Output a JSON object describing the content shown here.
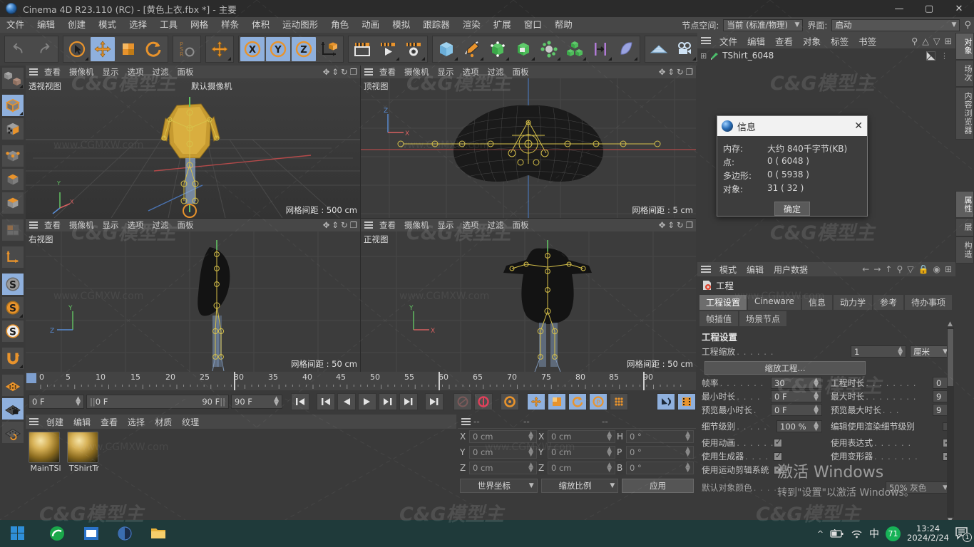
{
  "window": {
    "title": "Cinema 4D R23.110 (RC) - [黄色上衣.fbx *] - 主要",
    "logo_icon": "c4d-logo-icon",
    "minimize": "—",
    "maximize": "▢",
    "close": "✕"
  },
  "menubar": {
    "items": [
      "文件",
      "编辑",
      "创建",
      "模式",
      "选择",
      "工具",
      "网格",
      "样条",
      "体积",
      "运动图形",
      "角色",
      "动画",
      "模拟",
      "跟踪器",
      "渲染",
      "扩展",
      "窗口",
      "帮助"
    ],
    "right": {
      "node_space_label": "节点空间:",
      "node_space_value": "当前 (标准/物理)",
      "layout_label": "界面:",
      "layout_value": "启动",
      "search_icon": "search-icon"
    }
  },
  "viewports": [
    {
      "menu": [
        "查看",
        "摄像机",
        "显示",
        "选项",
        "过滤",
        "面板"
      ],
      "label": "透视视图",
      "camera": "默认摄像机",
      "grid": "网格间距 : 500 cm"
    },
    {
      "menu": [
        "查看",
        "摄像机",
        "显示",
        "选项",
        "过滤",
        "面板"
      ],
      "label": "顶视图",
      "camera": "",
      "grid": "网格间距 : 5 cm"
    },
    {
      "menu": [
        "查看",
        "摄像机",
        "显示",
        "选项",
        "过滤",
        "面板"
      ],
      "label": "右视图",
      "camera": "",
      "grid": "网格间距 : 50 cm"
    },
    {
      "menu": [
        "查看",
        "摄像机",
        "显示",
        "选项",
        "过滤",
        "面板"
      ],
      "label": "正视图",
      "camera": "",
      "grid": "网格间距 : 50 cm"
    }
  ],
  "timeline": {
    "ticks": [
      "0",
      "5",
      "10",
      "15",
      "20",
      "25",
      "30",
      "35",
      "40",
      "45",
      "50",
      "55",
      "60",
      "65",
      "70",
      "75",
      "80",
      "85",
      "90"
    ],
    "current_frame": "0 F",
    "range_start": "0 F",
    "range_end": "90 F",
    "max_frame": "90 F",
    "end_field": "0 F",
    "transport_icons": [
      "go-to-start-icon",
      "go-to-previous-key-icon",
      "step-back-icon",
      "play-back-icon",
      "play-icon",
      "step-forward-icon",
      "go-to-next-key-icon",
      "go-to-end-icon"
    ],
    "record_icons": [
      "autokey-icon",
      "record-active-icon",
      "keyframe-settings-icon"
    ],
    "psr_icons": [
      "position-key-icon",
      "scale-key-icon",
      "rotation-key-icon",
      "param-key-icon",
      "point-level-anim-icon"
    ],
    "right_icons": [
      "sound-icon",
      "film-icon"
    ]
  },
  "material_manager": {
    "menu": [
      "创建",
      "编辑",
      "查看",
      "选择",
      "材质",
      "纹理"
    ],
    "materials": [
      {
        "name": "MainTSl",
        "icon": "material-sphere-icon"
      },
      {
        "name": "TShirtTr",
        "icon": "material-sphere-icon"
      }
    ]
  },
  "coordinates": {
    "headers": [
      "--",
      "--",
      "--"
    ],
    "rows": [
      {
        "axis1": "X",
        "v1": "0 cm",
        "axis2": "X",
        "v2": "0 cm",
        "axis3": "H",
        "v3": "0 °"
      },
      {
        "axis1": "Y",
        "v1": "0 cm",
        "axis2": "Y",
        "v2": "0 cm",
        "axis3": "P",
        "v3": "0 °"
      },
      {
        "axis1": "Z",
        "v1": "0 cm",
        "axis2": "Z",
        "v2": "0 cm",
        "axis3": "B",
        "v3": "0 °"
      }
    ],
    "coord_system": "世界坐标",
    "scale_mode": "缩放比例",
    "apply": "应用"
  },
  "object_manager": {
    "menu": [
      "文件",
      "编辑",
      "查看",
      "对象",
      "标签",
      "书签"
    ],
    "icons": [
      "search-icon",
      "home-icon",
      "filter-icon",
      "add-icon"
    ],
    "object": {
      "name": "TShirt_6048",
      "type_icon": "null-object-icon",
      "expand_icon": "expand-plus-icon",
      "tag_icon": "display-tag-icon"
    }
  },
  "attributes": {
    "menu": [
      "模式",
      "编辑",
      "用户数据"
    ],
    "icons": [
      "back-arrow-icon",
      "forward-arrow-icon",
      "up-arrow-icon",
      "search-icon",
      "filter-icon",
      "lock-icon",
      "record-icon",
      "add-icon"
    ],
    "object_label": "工程",
    "object_icon": "project-settings-icon",
    "tabs": [
      "工程设置",
      "Cineware",
      "信息",
      "动力学",
      "参考",
      "待办事项",
      "帧插值",
      "场景节点"
    ],
    "active_tab": "工程设置",
    "section_title": "工程设置",
    "props": {
      "project_scale_label": "工程缩放",
      "project_scale_value": "1",
      "project_unit": "厘米",
      "scale_project_button": "缩放工程...",
      "fps_label": "帧率",
      "fps_value": "30",
      "project_length_label": "工程时长",
      "project_length_value": "0",
      "min_length_label": "最小时长",
      "min_length_value": "0 F",
      "max_length_label": "最大时长",
      "max_length_value": "9",
      "preview_min_label": "预览最小时长",
      "preview_min_value": "0 F",
      "preview_max_label": "预览最大时长",
      "preview_max_value": "9",
      "lod_label": "细节级别",
      "lod_value": "100 %",
      "render_lod_label": "编辑使用渲染细节级别",
      "use_animation_label": "使用动画",
      "use_expressions_label": "使用表达式",
      "use_generators_label": "使用生成器",
      "use_deformers_label": "使用变形器",
      "use_motion_clip_label": "使用运动剪辑系统",
      "default_color_label": "默认对象颜色",
      "default_color_value": "50% 灰色"
    }
  },
  "dock_tabs_top": [
    "对象",
    "场次",
    "内容浏览器"
  ],
  "dock_tabs_bottom": [
    "属性",
    "层",
    "构造"
  ],
  "info_dialog": {
    "title": "信息",
    "icon": "c4d-logo-icon",
    "close_icon": "close-icon",
    "rows": [
      {
        "key": "内存:",
        "value": "大约 840千字节(KB)"
      },
      {
        "key": "点:",
        "value": "0 ( 6048 )"
      },
      {
        "key": "多边形:",
        "value": "0 ( 5938 )"
      },
      {
        "key": "对象:",
        "value": "31 ( 32 )"
      }
    ],
    "ok_button": "确定"
  },
  "activate_windows": {
    "line1": "激活 Windows",
    "line2": "转到\"设置\"以激活 Windows。"
  },
  "taskbar": {
    "start_icon": "windows-start-icon",
    "items": [
      "browser-icon",
      "store-icon",
      "c4d-icon",
      "explorer-icon"
    ],
    "tray": [
      "chevron-up-icon",
      "battery-icon",
      "wifi-icon",
      "ime-chinese-icon",
      "green-badge-71"
    ],
    "badge": "71",
    "ime": "中",
    "time": "13:24",
    "date": "2024/2/24",
    "notification_icon": "notification-icon",
    "notification_count": "1"
  },
  "watermarks": {
    "site": "www.CGMXW.com",
    "brand": "C&G模型主"
  },
  "colors": {
    "accent_orange": "#e8932c",
    "selection_blue": "#8fb0dd",
    "panel_bg": "#3a3a3a",
    "header_bg": "#474747",
    "taskbar_bg": "#1f3a3a"
  }
}
